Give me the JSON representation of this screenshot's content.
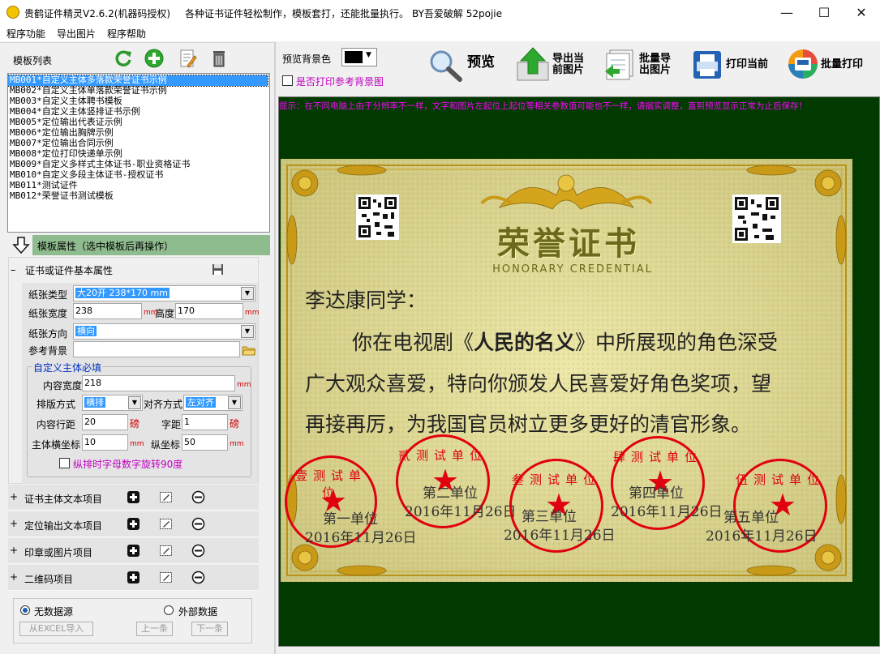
{
  "window": {
    "title": "贵鹤证件精灵V2.6.2(机器码授权)",
    "subtitle": "各种证书证件轻松制作，模板套打，还能批量执行。",
    "credit": "BY吾爱破解 52pojie"
  },
  "menu": [
    "程序功能",
    "导出图片",
    "程序帮助"
  ],
  "left": {
    "template_list_label": "模板列表",
    "templates": [
      "MB001*自定义主体多落款荣誉证书示例",
      "MB002*自定义主体单落款荣誉证书示例",
      "MB003*自定义主体聘书模板",
      "MB004*自定义主体竖排证书示例",
      "MB005*定位输出代表证示例",
      "MB006*定位输出胸牌示例",
      "MB007*定位输出合同示例",
      "MB008*定位打印快递单示例",
      "MB009*自定义多样式主体证书-职业资格证书",
      "MB010*自定义多段主体证书-授权证书",
      "MB011*测试证件",
      "MB012*荣誉证书测试模板"
    ],
    "selected_index": 0,
    "attr_header": "模板属性（选中模板后再操作）",
    "basic_section": "证书或证件基本属性",
    "paper_type_label": "纸张类型",
    "paper_type_value": "大20开 238*170 mm",
    "paper_width_label": "纸张宽度",
    "paper_width_value": "238",
    "paper_height_label": "高度",
    "paper_height_value": "170",
    "unit_mm": "mm",
    "orientation_label": "纸张方向",
    "orientation_value": "横向",
    "ref_bg_label": "参考背景",
    "ref_bg_value": "",
    "group_title": "自定义主体必填",
    "content_width_label": "内容宽度",
    "content_width_value": "218",
    "layout_label": "排版方式",
    "layout_value": "横排",
    "align_label": "对齐方式",
    "align_value": "左对齐",
    "line_spacing_label": "内容行距",
    "line_spacing_value": "20",
    "unit_pound": "磅",
    "char_spacing_label": "字距",
    "char_spacing_value": "1",
    "x_label": "主体横坐标",
    "x_value": "10",
    "y_label": "纵坐标",
    "y_value": "50",
    "rotate_label": "纵排时字母数字旋转90度",
    "sections": [
      "证书主体文本项目",
      "定位输出文本项目",
      "印章或图片项目",
      "二维码项目"
    ],
    "radio_no_data": "无数据源",
    "radio_external": "外部数据",
    "import_excel": "从EXCEL导入",
    "prev": "上一条",
    "next": "下一条"
  },
  "toolbar": {
    "preview_bg_label": "预览背景色",
    "print_ref_bg_label": "是否打印参考背景图",
    "preview": "预览",
    "export_current_1": "导出当",
    "export_current_2": "前图片",
    "batch_export_1": "批量导",
    "batch_export_2": "出图片",
    "print_current": "打印当前",
    "batch_print": "批量打印",
    "hint": "提示：在不同电脑上由于分辨率不一样，文字和图片左起位上起位等相关参数值可能也不一样，请据实调整，直到预览显示正常为止后保存！"
  },
  "certificate": {
    "title": "荣誉证书",
    "subtitle": "HONORARY CREDENTIAL",
    "salutation": "李达康同学：",
    "para_1a": "你在电视剧《",
    "para_1b": "人民的名义",
    "para_1c": "》中所展现的角色深受",
    "para_2": "广大观众喜爱，特向你颁发人民喜爱好角色奖项，望",
    "para_3": "再接再厉，为我国官员树立更多更好的清官形象。",
    "units": [
      {
        "name": "第一单位",
        "date": "2016年11月26日",
        "seal": "壹测试单位"
      },
      {
        "name": "第二单位",
        "date": "2016年11月26日",
        "seal": "贰测试单位"
      },
      {
        "name": "第三单位",
        "date": "2016年11月26日",
        "seal": "叁测试单位"
      },
      {
        "name": "第四单位",
        "date": "2016年11月26日",
        "seal": "肆测试单位"
      },
      {
        "name": "第五单位",
        "date": "2016年11月26日",
        "seal": "伍测试单位"
      }
    ]
  },
  "colors": {
    "accent": "#3399ff",
    "hint": "#ff00ff",
    "canvas_bg": "#003a00",
    "seal": "#e0000f",
    "paper": "#d8d28a"
  }
}
